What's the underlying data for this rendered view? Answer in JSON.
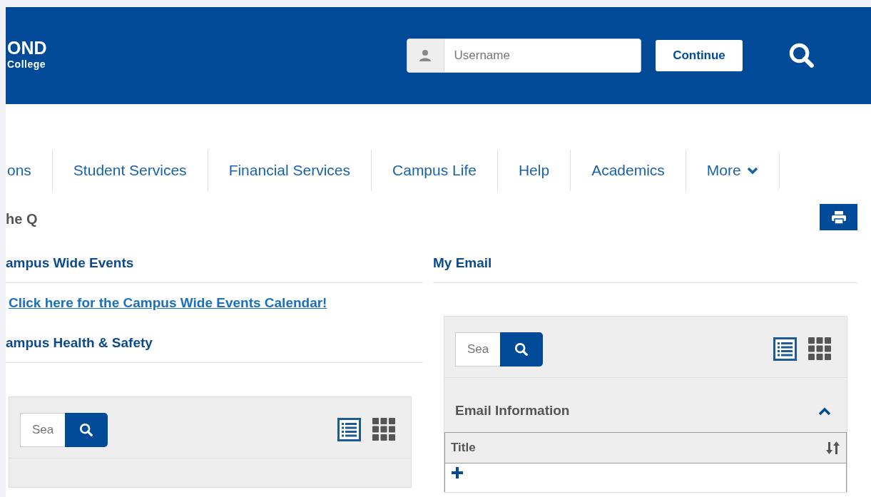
{
  "header": {
    "logo_lines": [
      "OND",
      "College"
    ],
    "username": {
      "placeholder": "Username"
    },
    "continue_button": "Continue"
  },
  "nav": [
    {
      "label": "ons",
      "kind": "link"
    },
    {
      "label": "Student Services",
      "kind": "link"
    },
    {
      "label": "Financial Services",
      "kind": "link"
    },
    {
      "label": "Campus Life",
      "kind": "link"
    },
    {
      "label": "Help",
      "kind": "link"
    },
    {
      "label": "Academics",
      "kind": "link"
    },
    {
      "label": "More",
      "kind": "dropdown"
    }
  ],
  "page_title": "he Q",
  "left_sections": [
    {
      "title": "ampus Wide Events",
      "link": "Click here for the Campus Wide Events Calendar!"
    },
    {
      "title": "ampus Health & Safety",
      "panel": {
        "search_placeholder": "Sea"
      }
    }
  ],
  "right_sections": [
    {
      "title": "My Email",
      "panel": {
        "search_placeholder": "Sea",
        "group": {
          "title": "Email Information",
          "expanded": true
        },
        "table": {
          "columns": [
            "Title"
          ]
        }
      }
    }
  ]
}
